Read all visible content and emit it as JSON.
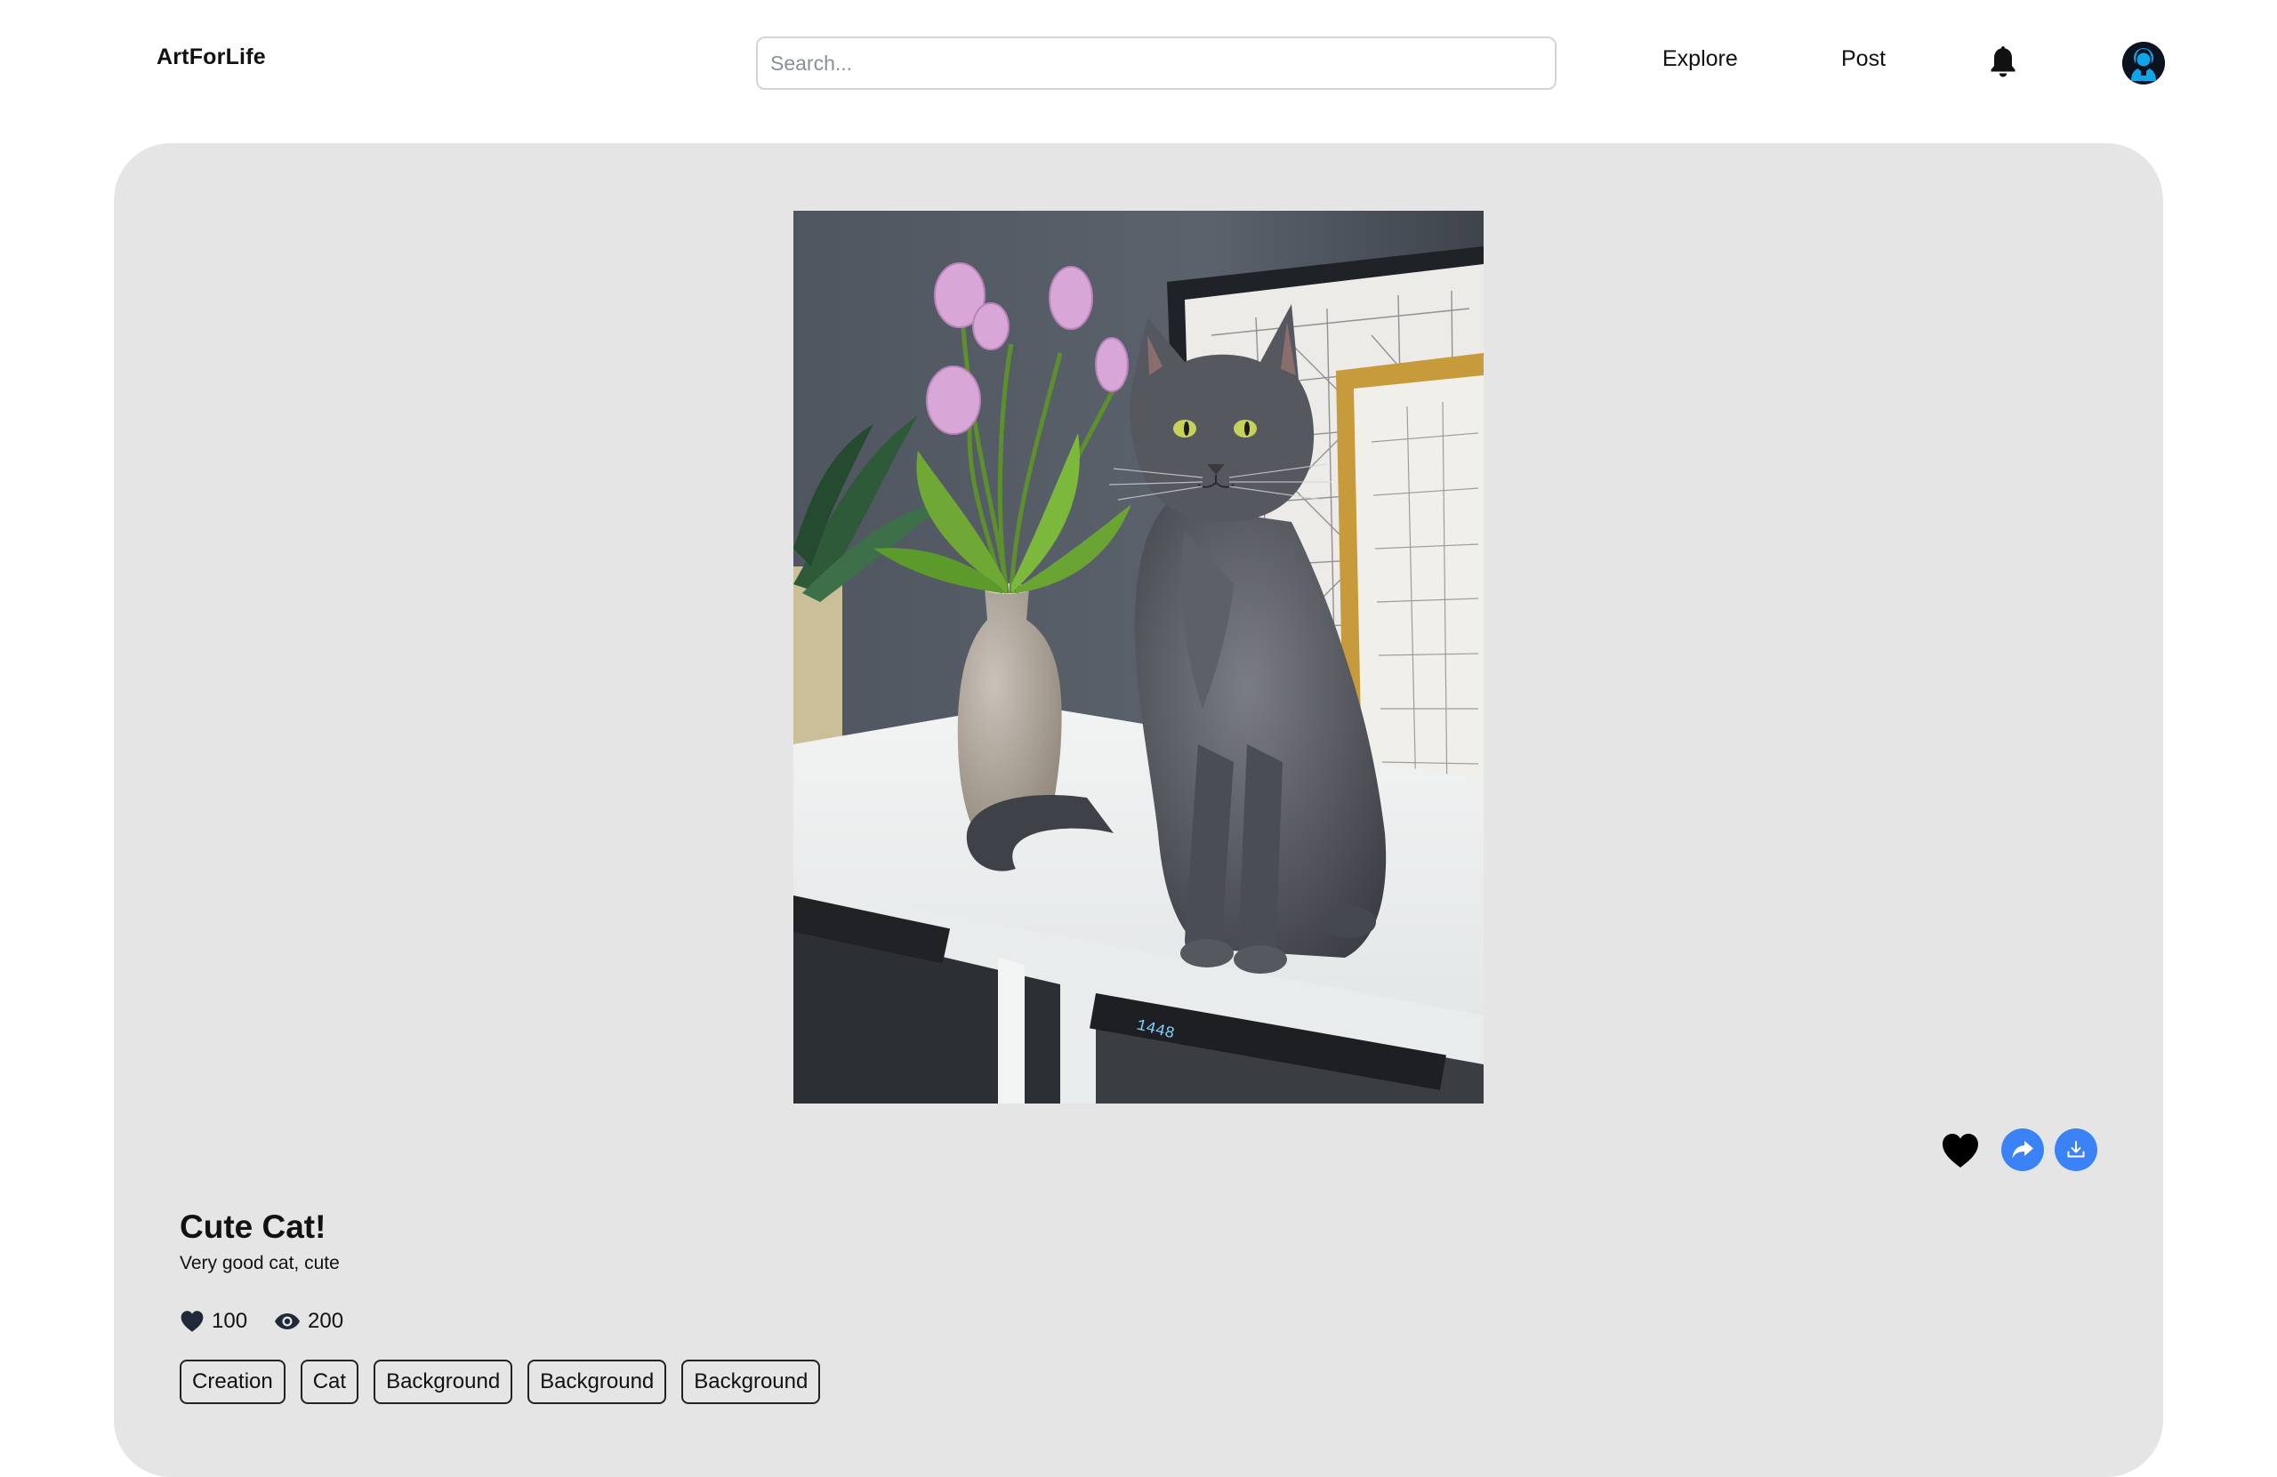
{
  "header": {
    "logo": "ArtForLife",
    "search_placeholder": "Search...",
    "nav": {
      "explore": "Explore",
      "post": "Post"
    }
  },
  "post": {
    "title": "Cute Cat!",
    "description": "Very good cat, cute",
    "likes": "100",
    "views": "200",
    "tags": [
      "Creation",
      "Cat",
      "Background",
      "Background",
      "Background"
    ]
  },
  "colors": {
    "accent": "#3b82f6",
    "card_background": "#e5e5e5",
    "avatar_ring": "#0ea5e9"
  },
  "icons": {
    "notifications": "bell-icon",
    "avatar": "user-avatar-icon",
    "like": "heart-icon",
    "share": "share-icon",
    "download": "download-icon",
    "views": "eye-icon"
  }
}
